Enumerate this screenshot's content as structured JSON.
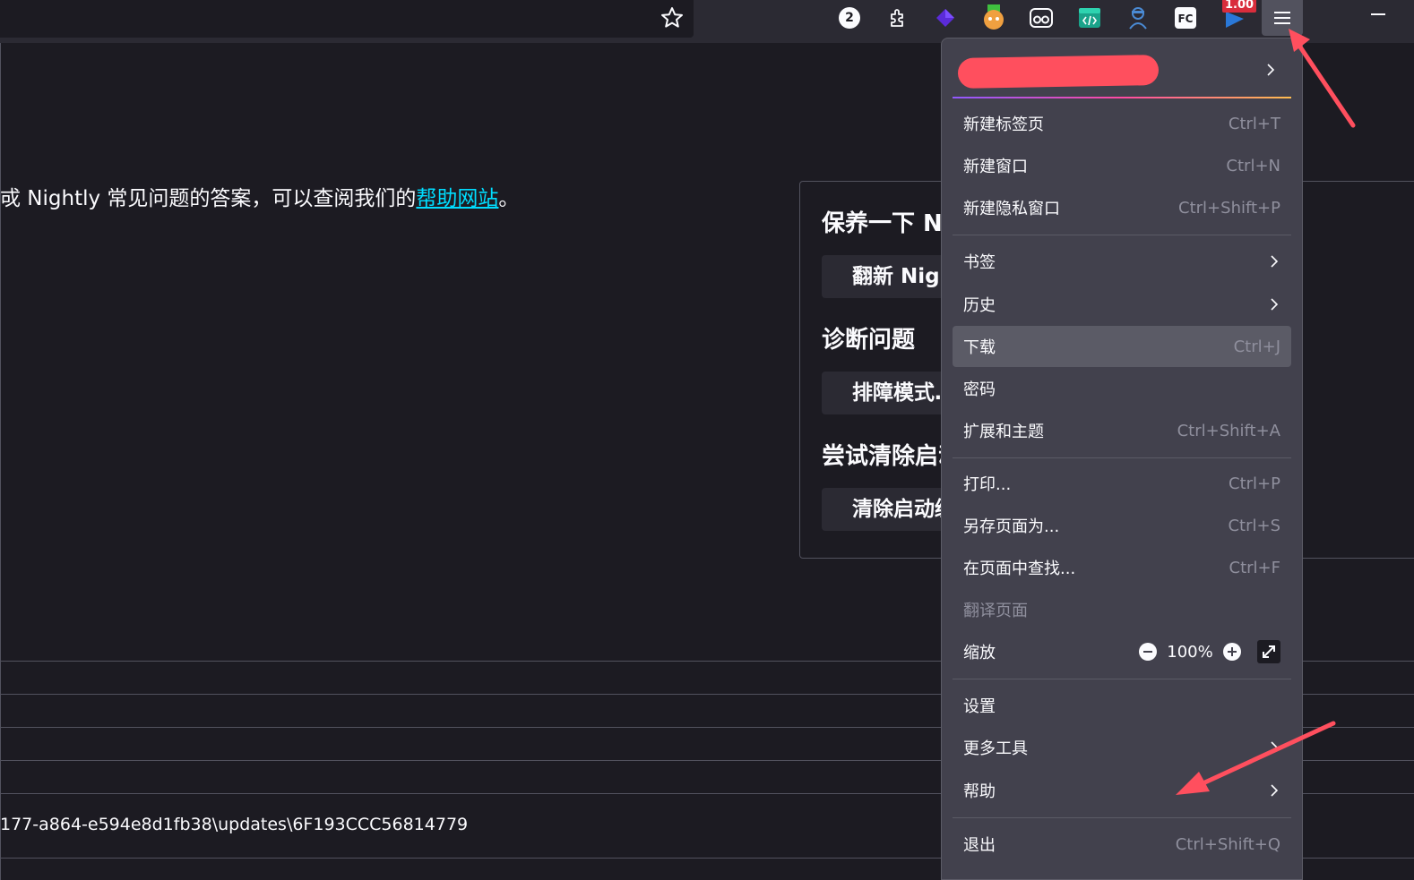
{
  "toolbar": {
    "notification_count": "2",
    "version_badge": "1.00"
  },
  "page": {
    "intro_prefix": "戓 Nightly 常见问题的答案，可以查阅我们的",
    "intro_link": "帮助网站",
    "intro_suffix": "。",
    "card": {
      "heading_1": "保养一下 Ni",
      "button_1": "翻新 Nigh",
      "heading_2": "诊断问题",
      "button_2": "排障模式…",
      "heading_3": "尝试清除启动",
      "button_3": "清除启动缓"
    },
    "path_text": "177-a864-e594e8d1fb38\\updates\\6F193CCC56814779"
  },
  "menu": {
    "items": [
      {
        "label": "新建标签页",
        "shortcut": "Ctrl+T"
      },
      {
        "label": "新建窗口",
        "shortcut": "Ctrl+N"
      },
      {
        "label": "新建隐私窗口",
        "shortcut": "Ctrl+Shift+P"
      },
      {
        "label": "书签",
        "shortcut": ""
      },
      {
        "label": "历史",
        "shortcut": ""
      },
      {
        "label": "下载",
        "shortcut": "Ctrl+J"
      },
      {
        "label": "密码",
        "shortcut": ""
      },
      {
        "label": "扩展和主题",
        "shortcut": "Ctrl+Shift+A"
      },
      {
        "label": "打印...",
        "shortcut": "Ctrl+P"
      },
      {
        "label": "另存页面为...",
        "shortcut": "Ctrl+S"
      },
      {
        "label": "在页面中查找...",
        "shortcut": "Ctrl+F"
      },
      {
        "label": "翻译页面",
        "shortcut": ""
      },
      {
        "label": "缩放",
        "shortcut": ""
      },
      {
        "label": "设置",
        "shortcut": ""
      },
      {
        "label": "更多工具",
        "shortcut": ""
      },
      {
        "label": "帮助",
        "shortcut": ""
      },
      {
        "label": "退出",
        "shortcut": "Ctrl+Shift+Q"
      }
    ],
    "zoom_value": "100%"
  },
  "colors": {
    "menu_bg": "#42414d",
    "highlight": "#5b5b66",
    "link": "#00ddff",
    "annotation": "#ff4f5e"
  }
}
